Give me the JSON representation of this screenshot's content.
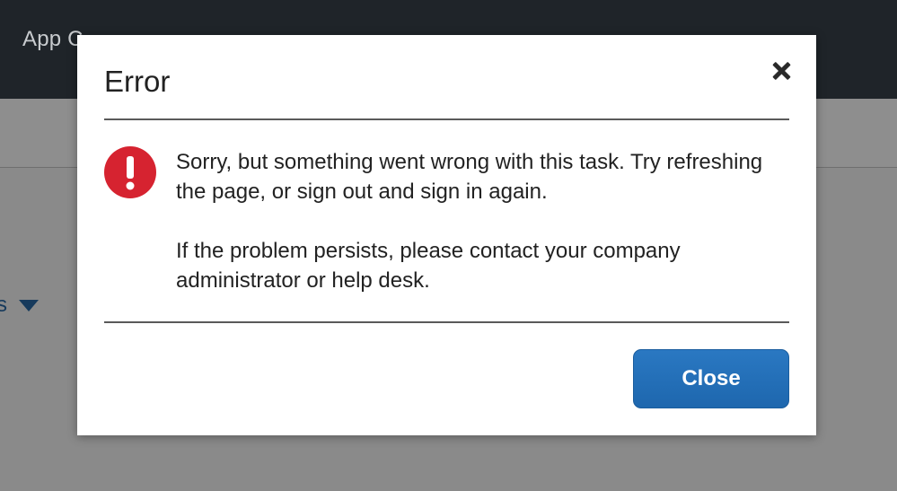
{
  "app": {
    "title": "App C",
    "dropdown_label": "s"
  },
  "dialog": {
    "title": "Error",
    "icon": "error-exclamation-icon",
    "message_line1": "Sorry, but something went wrong with this task. Try refreshing the page, or sign out and sign in again.",
    "message_line2": "If the problem persists, please contact your company administrator or help desk.",
    "close_button_label": "Close"
  },
  "colors": {
    "accent": "#1e6fbf",
    "error": "#d62330",
    "header_bg": "#1f2429"
  }
}
